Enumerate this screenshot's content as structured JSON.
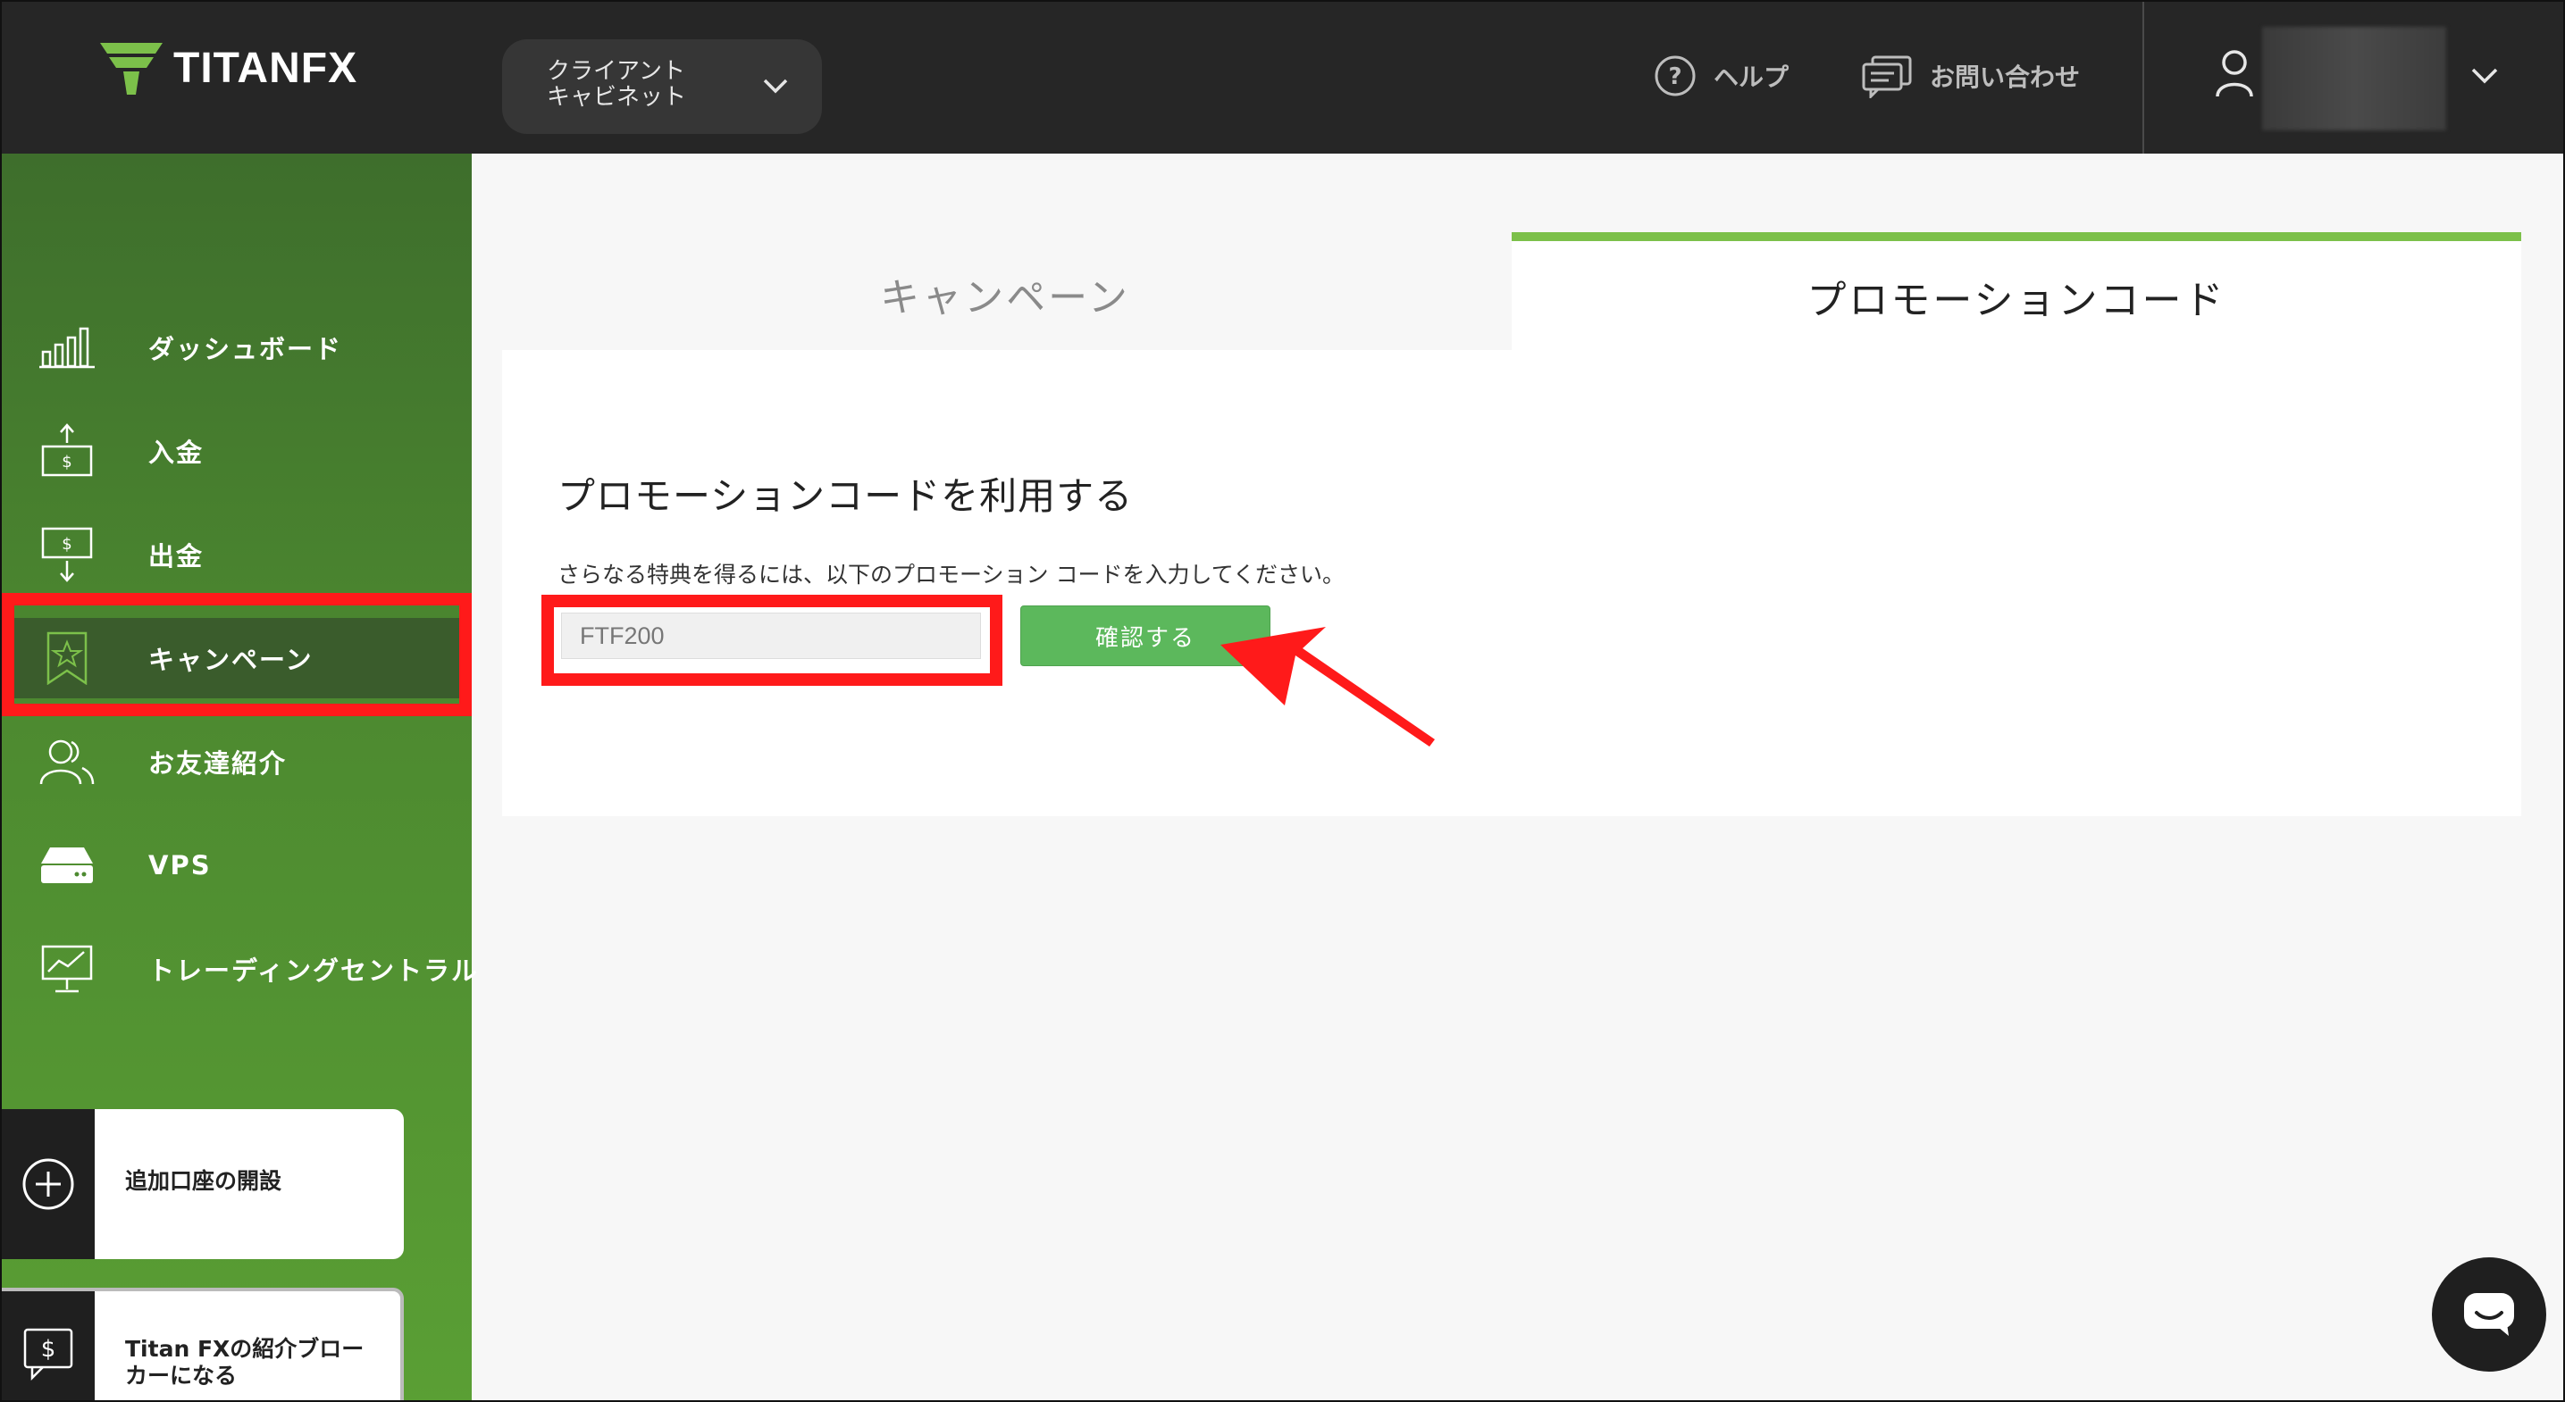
{
  "header": {
    "logo_text_a": "TITAN",
    "logo_text_b": "FX",
    "cabinet_label": "クライアント\nキャビネット",
    "help_label": "ヘルプ",
    "contact_label": "お問い合わせ"
  },
  "sidebar": {
    "items": [
      {
        "label": "ダッシュボード",
        "icon": "bar-chart-icon"
      },
      {
        "label": "入金",
        "icon": "deposit-icon"
      },
      {
        "label": "出金",
        "icon": "withdraw-icon"
      },
      {
        "label": "キャンペーン",
        "icon": "star-badge-icon"
      },
      {
        "label": "お友達紹介",
        "icon": "users-icon"
      },
      {
        "label": "VPS",
        "icon": "server-icon"
      },
      {
        "label": "トレーディングセントラル",
        "icon": "monitor-chart-icon"
      }
    ],
    "cards": [
      {
        "label": "追加口座の開設",
        "icon": "plus-circle-icon"
      },
      {
        "label": "Titan FXの紹介ブロー\nカーになる",
        "icon": "dollar-chat-icon"
      }
    ]
  },
  "tabs": {
    "campaign": "キャンペーン",
    "promo": "プロモーションコード"
  },
  "promo": {
    "title": "プロモーションコードを利用する",
    "description": "さらなる特典を得るには、以下のプロモーション コードを入力してください。",
    "input_value": "FTF200",
    "confirm_label": "確認する"
  },
  "colors": {
    "header_bg": "#262626",
    "accent_green": "#7cc04a",
    "button_green": "#5cb85c",
    "highlight_red": "#ff1a1a"
  }
}
